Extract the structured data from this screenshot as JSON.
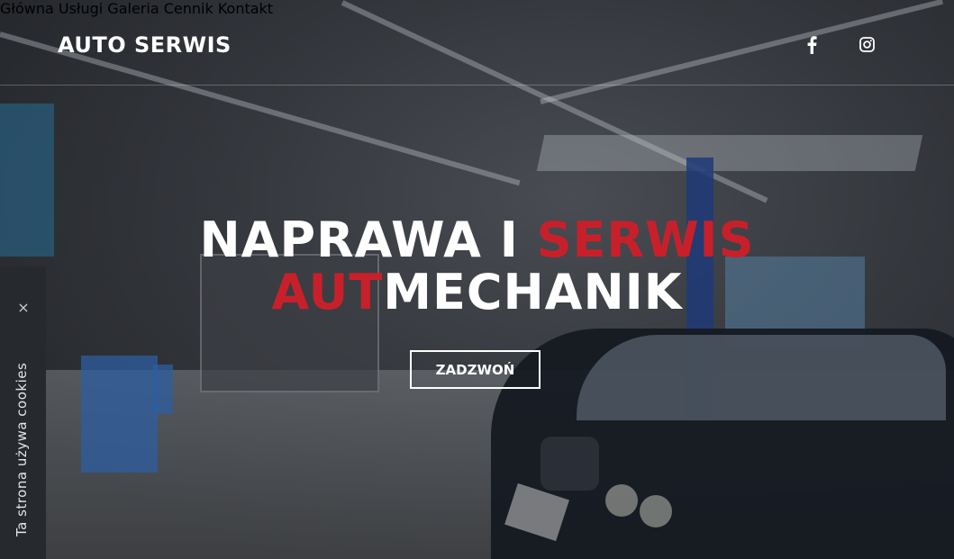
{
  "header": {
    "logo": "AUTO SERWIS",
    "nav": [
      {
        "label": "Główna"
      },
      {
        "label": "Usługi"
      },
      {
        "label": "Galeria"
      },
      {
        "label": "Cennik"
      },
      {
        "label": "Kontakt"
      }
    ],
    "social": [
      {
        "icon": "facebook-icon",
        "glyph": "f"
      },
      {
        "icon": "instagram-icon"
      }
    ]
  },
  "hero": {
    "line1_white": "NAPRAWA I ",
    "line1_red": "SERWIS",
    "line2_red": "AUT",
    "line2_white": "MECHANIK",
    "cta": "ZADZWOŃ"
  },
  "cookie": {
    "text": "Ta strona używa cookies",
    "close_glyph": "×"
  },
  "colors": {
    "accent": "#c8202a",
    "text": "#ffffff",
    "cookie_bg": "#26292d"
  }
}
